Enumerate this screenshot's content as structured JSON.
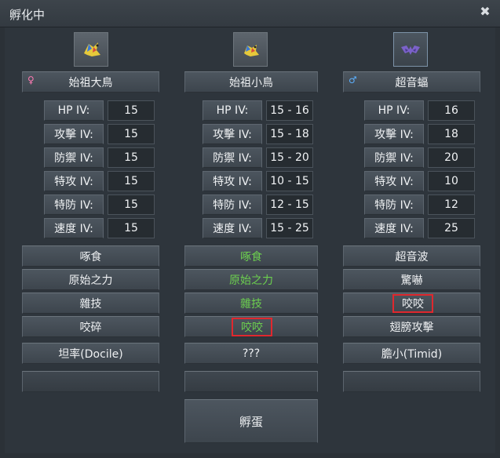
{
  "window": {
    "title": "孵化中",
    "close_glyph": "✖"
  },
  "parents": [
    {
      "name": "始祖大鳥",
      "gender": "♀",
      "gender_type": "female",
      "iv_labels": [
        "HP IV:",
        "攻擊 IV:",
        "防禦 IV:",
        "特攻 IV:",
        "特防 IV:",
        "速度 IV:"
      ],
      "ivs": [
        "15",
        "15",
        "15",
        "15",
        "15",
        "15"
      ],
      "moves": [
        "啄食",
        "原始之力",
        "雜技",
        "咬碎"
      ],
      "nature": "坦率(Docile)",
      "extra": ""
    },
    {
      "name": "始祖小鳥",
      "gender": "",
      "gender_type": "none",
      "iv_labels": [
        "HP IV:",
        "攻擊 IV:",
        "防禦 IV:",
        "特攻 IV:",
        "特防 IV:",
        "速度 IV:"
      ],
      "ivs": [
        "15 - 16",
        "15 - 18",
        "15 - 20",
        "10 - 15",
        "12 - 15",
        "15 - 25"
      ],
      "moves": [
        "啄食",
        "原始之力",
        "雜技",
        "咬咬"
      ],
      "nature": "???",
      "extra": ""
    },
    {
      "name": "超音蝠",
      "gender": "♂",
      "gender_type": "male",
      "iv_labels": [
        "HP IV:",
        "攻擊 IV:",
        "防禦 IV:",
        "特攻 IV:",
        "特防 IV:",
        "速度 IV:"
      ],
      "ivs": [
        "16",
        "18",
        "20",
        "10",
        "12",
        "25"
      ],
      "moves": [
        "超音波",
        "驚嚇",
        "咬咬",
        "翅膀攻擊"
      ],
      "nature": "膽小(Timid)",
      "extra": ""
    }
  ],
  "hatch_button": "孵蛋",
  "colors": {
    "inherited_move": "#6ccf4f",
    "highlight": "#e0282e",
    "female": "#ff7ab3",
    "male": "#5cb0ff"
  },
  "icons": [
    "archeops-sprite-icon",
    "archen-sprite-icon",
    "zubat-sprite-icon"
  ]
}
